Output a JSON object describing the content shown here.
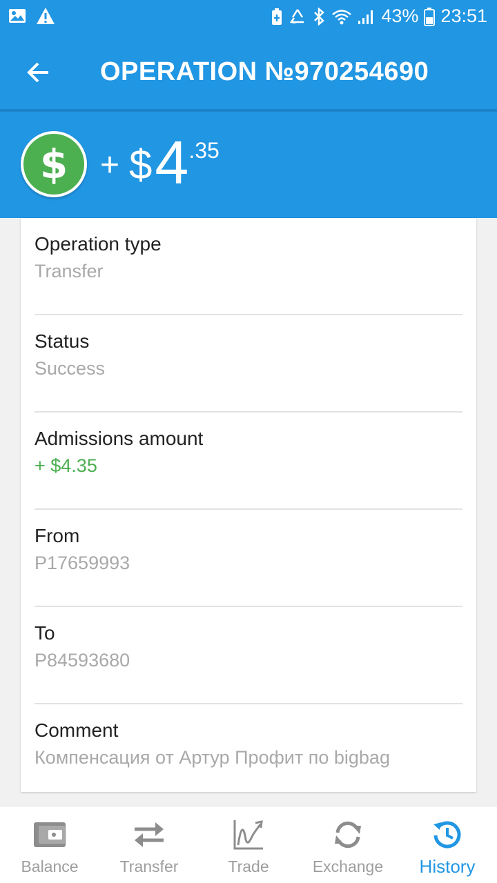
{
  "status_bar": {
    "battery_percent": "43%",
    "time": "23:51",
    "icons": [
      "image-icon",
      "warning-icon",
      "battery-saver-icon",
      "recycle-icon",
      "bluetooth-icon",
      "wifi-icon",
      "signal-icon",
      "battery-icon"
    ]
  },
  "app_bar": {
    "title": "OPERATION №970254690",
    "back_icon": "arrow-back-icon"
  },
  "amount_header": {
    "icon": "dollar-icon",
    "sign": "+",
    "currency": "$",
    "integer": "4",
    "fraction": ".35"
  },
  "details": [
    {
      "label": "Operation type",
      "value": "Transfer"
    },
    {
      "label": "Status",
      "value": "Success"
    },
    {
      "label": "Admissions amount",
      "value": "+ $4.35"
    },
    {
      "label": "From",
      "value": "P17659993"
    },
    {
      "label": "To",
      "value": "P84593680"
    },
    {
      "label": "Comment",
      "value": "Компенсация от Артур Профит по bigbag"
    }
  ],
  "bottom_nav": {
    "items": [
      {
        "label": "Balance",
        "icon": "wallet-icon",
        "active": false
      },
      {
        "label": "Transfer",
        "icon": "swap-arrows-icon",
        "active": false
      },
      {
        "label": "Trade",
        "icon": "chart-trend-icon",
        "active": false
      },
      {
        "label": "Exchange",
        "icon": "refresh-icon",
        "active": false
      },
      {
        "label": "History",
        "icon": "history-clock-icon",
        "active": true
      }
    ]
  },
  "colors": {
    "primary": "#2196e3",
    "positive": "#4caf50",
    "muted_text": "#a9a9a9"
  }
}
